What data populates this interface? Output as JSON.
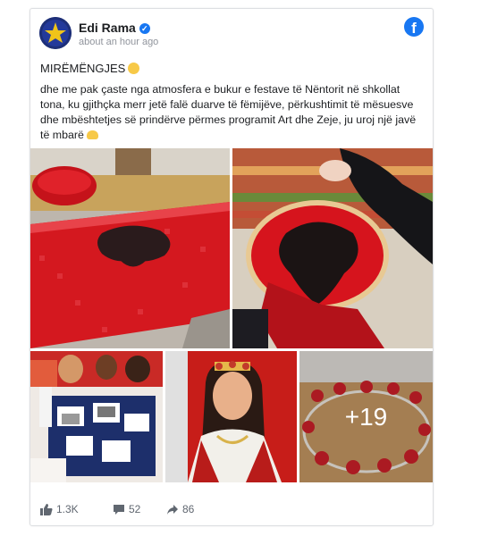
{
  "post": {
    "author": "Edi Rama",
    "time": "about an hour ago",
    "greeting": "MIRËMËNGJES",
    "body": "dhe me pak çaste nga atmosfera e bukur e festave të Nëntorit në shkollat tona, ku gjithçka merr jetë falë duarve të fëmijëve, përkushtimit të mësuesve dhe mbështetjes së prindërve përmes programit Art dhe Zeje, ju uroj një javë të mbarë",
    "more_photos": "+19"
  },
  "footer": {
    "likes": "1.3K",
    "comments": "52",
    "shares": "86"
  },
  "colors": {
    "facebook_blue": "#1877f2",
    "flag_red": "#d0141c"
  }
}
